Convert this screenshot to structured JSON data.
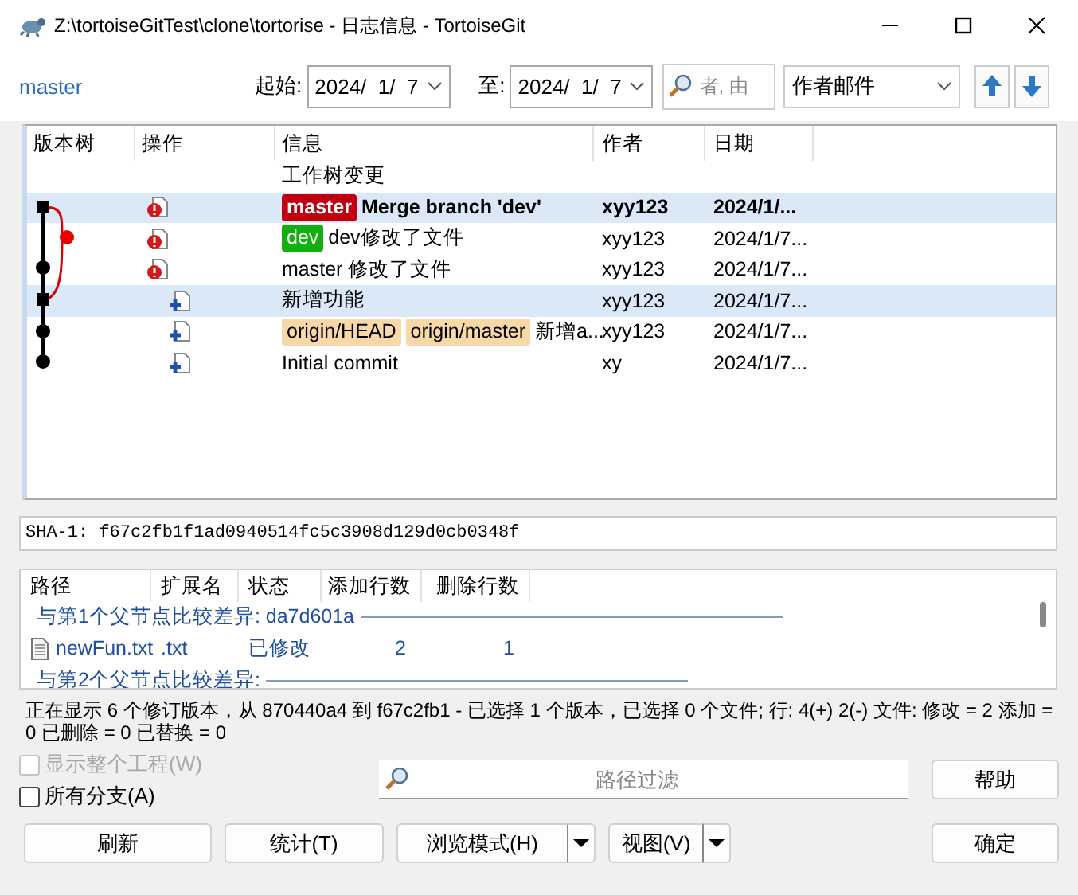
{
  "window": {
    "title": "Z:\\tortoiseGitTest\\clone\\tortorise - 日志信息 - TortoiseGit"
  },
  "toolbar": {
    "branch": "master",
    "from_label": "起始:",
    "from_date": "2024/  1/  7",
    "to_label": "至:",
    "to_date": "2024/  1/  7",
    "search": {
      "placeholder": "者, 由"
    },
    "filter_field": "作者邮件"
  },
  "log": {
    "columns": [
      "版本树",
      "操作",
      "信息",
      "作者",
      "日期"
    ],
    "rows": [
      {
        "message": "工作树变更",
        "refs": [],
        "author": "",
        "date": "",
        "kind": "worktree",
        "bold": false,
        "selected": false
      },
      {
        "message": "Merge branch 'dev'",
        "refs": [
          {
            "label": "master",
            "color": "#c00010"
          }
        ],
        "author": "xyy123",
        "date": "2024/1/...",
        "kind": "conflict",
        "bold": true,
        "selected": true
      },
      {
        "message": "dev修改了文件",
        "refs": [
          {
            "label": "dev",
            "color": "#10b010"
          }
        ],
        "author": "xyy123",
        "date": "2024/1/7...",
        "kind": "conflict",
        "bold": false,
        "selected": false
      },
      {
        "message": "master 修改了文件",
        "refs": [],
        "author": "xyy123",
        "date": "2024/1/7...",
        "kind": "conflict",
        "bold": false,
        "selected": false
      },
      {
        "message": "新增功能",
        "refs": [],
        "author": "xyy123",
        "date": "2024/1/7...",
        "kind": "add",
        "bold": false,
        "selected": true
      },
      {
        "message": "新增a...",
        "refs": [
          {
            "label": "origin/HEAD",
            "color": "#f8d8a8"
          },
          {
            "label": "origin/master",
            "color": "#f8d8a8"
          }
        ],
        "author": "xyy123",
        "date": "2024/1/7...",
        "kind": "add",
        "bold": false,
        "selected": false
      },
      {
        "message": "Initial commit",
        "refs": [],
        "author": "xy",
        "date": "2024/1/7...",
        "kind": "add",
        "bold": false,
        "selected": false
      }
    ]
  },
  "sha": "SHA-1: f67c2fb1f1ad0940514fc5c3908d129d0cb0348f",
  "files": {
    "columns": [
      "路径",
      "扩展名",
      "状态",
      "添加行数",
      "删除行数"
    ],
    "rows": [
      {
        "kind": "group",
        "title": "与第1个父节点比较差异: da7d601a"
      },
      {
        "kind": "file",
        "path": "newFun.txt",
        "ext": ".txt",
        "status": "已修改",
        "added": "2",
        "deleted": "1"
      },
      {
        "kind": "group",
        "title": "与第2个父节点比较差异:"
      }
    ]
  },
  "status_text": "正在显示 6 个修订版本，从 870440a4 到 f67c2fb1 - 已选择 1 个版本，已选择 0 个文件; 行: 4(+) 2(-) 文件: 修改 = 2 添加 = 0 已删除 = 0 已替换 = 0",
  "options": [
    {
      "label": "显示整个工程(W)",
      "checked": false,
      "disabled": true
    },
    {
      "label": "所有分支(A)",
      "checked": false,
      "disabled": false
    }
  ],
  "path_filter": {
    "placeholder": "路径过滤"
  },
  "buttons": [
    {
      "label": "刷新",
      "kind": "plain"
    },
    {
      "label": "统计(T)",
      "kind": "plain"
    },
    {
      "label": "浏览模式(H)",
      "kind": "split"
    },
    {
      "label": "视图(V)",
      "kind": "split"
    }
  ],
  "help_button": "帮助",
  "ok_button": "确定"
}
